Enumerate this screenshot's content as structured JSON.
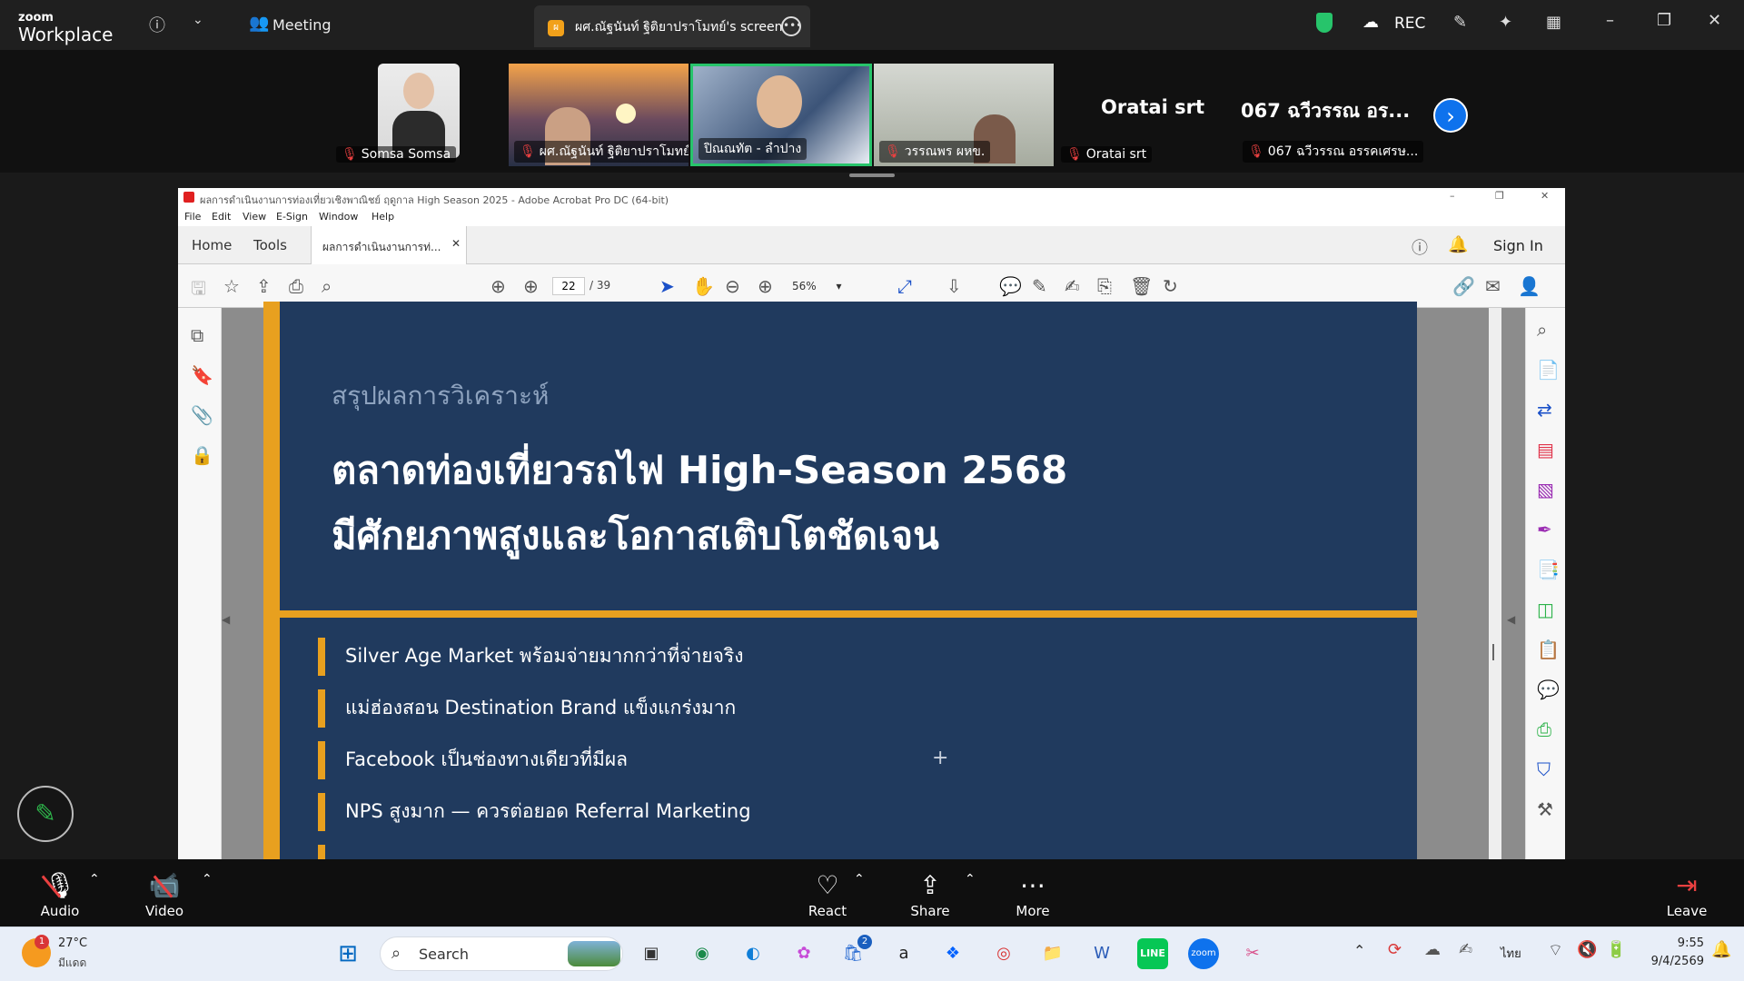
{
  "zoom": {
    "logo_small": "zoom",
    "logo_big": "Workplace",
    "meeting_label": "Meeting",
    "share_title": "ผศ.ณัฐนันท์ ฐิติยาปราโมทย์'s screen",
    "share_badge": "ผ",
    "rec_label": "REC",
    "participants": [
      {
        "name": "Somsa Somsa"
      },
      {
        "name": "ผศ.ณัฐนันท์ ฐิติยาปราโมทย์"
      },
      {
        "name": "ปิณณทัต - ลำปาง"
      },
      {
        "name": "วรรณพร ผหข."
      },
      {
        "name": "Oratai srt",
        "big_name": "Oratai srt"
      },
      {
        "name": "067 ฉวีวรรณ อรรคเศรษ...",
        "big_name": "067 ฉวีวรรณ อร..."
      }
    ],
    "controls": {
      "audio": "Audio",
      "video": "Video",
      "react": "React",
      "share": "Share",
      "more": "More",
      "leave": "Leave"
    }
  },
  "acrobat": {
    "title": "ผลการดำเนินงานการท่องเที่ยวเชิงพาณิชย์ ฤดูกาล High Season 2025 - Adobe Acrobat Pro DC (64-bit)",
    "menu": [
      "File",
      "Edit",
      "View",
      "E-Sign",
      "Window",
      "Help"
    ],
    "tabs": {
      "home": "Home",
      "tools": "Tools",
      "doc_tab": "ผลการดำเนินงานการท่..."
    },
    "sign_in": "Sign In",
    "page_current": "22",
    "page_total": "/ 39",
    "zoom_level": "56%"
  },
  "slide": {
    "subtitle": "สรุปผลการวิเคราะห์",
    "title_line1": "ตลาดท่องเที่ยวรถไฟ High-Season 2568",
    "title_line2": "มีศักยภาพสูงและโอกาสเติบโตชัดเจน",
    "bullets": [
      "Silver Age Market พร้อมจ่ายมากกว่าที่จ่ายจริง",
      "แม่ฮ่องสอน Destination Brand แข็งแกร่งมาก",
      "Facebook เป็นช่องทางเดียวที่มีผล",
      "NPS สูงมาก — ควรต่อยอด Referral Marketing"
    ]
  },
  "taskbar": {
    "weather_temp": "27°C",
    "weather_desc": "มีแดด",
    "weather_badge": "1",
    "search_placeholder": "Search",
    "store_badge": "2",
    "lang": "ไทย",
    "time": "9:55",
    "date": "9/4/2569"
  },
  "colors": {
    "slide_bg": "#203a5e",
    "slide_accent": "#e8a01f",
    "zoom_blue": "#0e72ed",
    "active_speaker": "#27c46b"
  }
}
